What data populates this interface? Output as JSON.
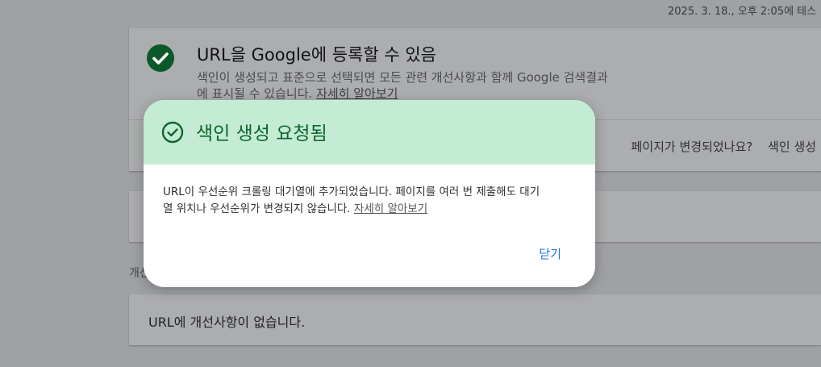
{
  "header": {
    "timestamp": "2025. 3. 18., 오후 2:05에 테스"
  },
  "status_card": {
    "title": "URL을 Google에 등록할 수 있음",
    "description_line1": "색인이 생성되고 표준으로 선택되면 모든 관련 개선사항과 함께 Google 검색결과",
    "description_line2": "에 표시될 수 있습니다.",
    "learn_more": "자세히 알아보기",
    "footer_question": "페이지가 변경되었나요?",
    "footer_action": "색인 생성"
  },
  "section_label": "개선",
  "improvements_card": {
    "text": "URL에 개선사항이 없습니다."
  },
  "dialog": {
    "title": "색인 생성 요청됨",
    "body_line1": "URL이 우선순위 크롤링 대기열에 추가되었습니다. 페이지를 여러 번 제출해도 대기",
    "body_line2": "열 위치나 우선순위가 변경되지 않습니다.",
    "learn_more": "자세히 알아보기",
    "close_label": "닫기"
  },
  "colors": {
    "success_green": "#0d652d",
    "dialog_header": "#c4ecd4",
    "link_blue": "#1a73e8"
  },
  "icons": [
    "check-circle-icon",
    "check-circle-outline-icon"
  ]
}
